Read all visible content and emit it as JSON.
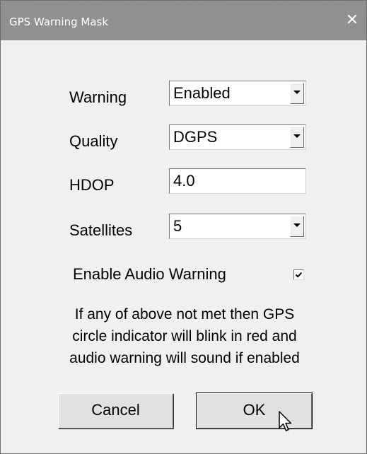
{
  "window": {
    "title": "GPS Warning Mask",
    "close_glyph": "✕"
  },
  "fields": {
    "warning": {
      "label": "Warning",
      "value": "Enabled"
    },
    "quality": {
      "label": "Quality",
      "value": "DGPS"
    },
    "hdop": {
      "label": "HDOP",
      "value": "4.0"
    },
    "satellites": {
      "label": "Satellites",
      "value": "5"
    }
  },
  "audio": {
    "label": "Enable Audio Warning",
    "checked": true
  },
  "info_lines": [
    "If any of above not met then GPS",
    "circle indicator will blink in red and",
    "audio warning will sound if enabled"
  ],
  "buttons": {
    "cancel": "Cancel",
    "ok": "OK"
  },
  "icons": {
    "dropdown": "chevron-down-icon",
    "close": "close-icon",
    "cursor": "mouse-pointer-icon"
  },
  "colors": {
    "titlebar": "#8e8e8e",
    "dialog_bg": "#f0f0f0",
    "field_bg": "#ffffff"
  }
}
